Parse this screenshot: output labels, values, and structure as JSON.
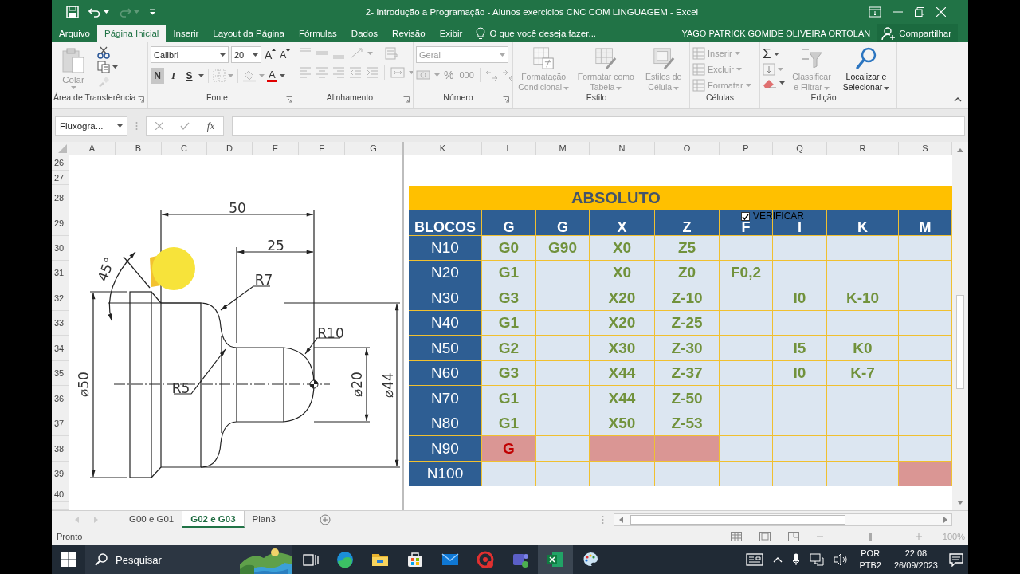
{
  "window": {
    "title": "2- Introdução a Programação - Alunos exercicios CNC COM LINGUAGEM - Excel"
  },
  "ribbon_tabs": [
    {
      "label": "Arquivo",
      "selected": false
    },
    {
      "label": "Página Inicial",
      "selected": true
    },
    {
      "label": "Inserir",
      "selected": false
    },
    {
      "label": "Layout da Página",
      "selected": false
    },
    {
      "label": "Fórmulas",
      "selected": false
    },
    {
      "label": "Dados",
      "selected": false
    },
    {
      "label": "Revisão",
      "selected": false
    },
    {
      "label": "Exibir",
      "selected": false
    }
  ],
  "tell_me": {
    "placeholder": "O que você deseja fazer..."
  },
  "user": "YAGO PATRICK GOMIDE OLIVEIRA ORTOLAN",
  "share_button": "Compartilhar",
  "ribbon": {
    "clipboard": {
      "label": "Área de Transferência",
      "paste": {
        "label": "Colar",
        "disabled": true
      }
    },
    "font": {
      "label": "Fonte",
      "font_name": "Calibri",
      "font_size": "20",
      "grow": "A",
      "shrink": "A",
      "font_color": "A",
      "toggles": [
        {
          "text": "N",
          "selected": true
        },
        {
          "text": "I",
          "selected": false
        },
        {
          "text": "S",
          "selected": false
        }
      ]
    },
    "alignment": {
      "label": "Alinhamento"
    },
    "number": {
      "label": "Número",
      "format": {
        "value": "Geral",
        "disabled": true
      },
      "percent": "%",
      "thousands": "000"
    },
    "styles": {
      "label": "Estilo",
      "buttons": [
        {
          "label": "Formatação Condicional",
          "disabled": true
        },
        {
          "label": "Formatar como Tabela",
          "disabled": true
        },
        {
          "label": "Estilos de Célula",
          "disabled": true
        }
      ]
    },
    "cells": {
      "label": "Células",
      "buttons": [
        {
          "label": "Inserir",
          "disabled": true
        },
        {
          "label": "Excluir",
          "disabled": true
        },
        {
          "label": "Formatar",
          "disabled": true
        }
      ]
    },
    "editing": {
      "label": "Edição",
      "sum": "Σ",
      "buttons": [
        {
          "label": "Classificar e Filtrar",
          "disabled": true
        },
        {
          "label": "Localizar e Selecionar",
          "disabled": false
        }
      ]
    }
  },
  "name_box": "Fluxogra...",
  "formula_bar": {
    "fx": "fx"
  },
  "left_columns": [
    "A",
    "B",
    "C",
    "D",
    "E",
    "F",
    "G"
  ],
  "right_columns": [
    "K",
    "L",
    "M",
    "N",
    "O",
    "P",
    "Q",
    "R",
    "S"
  ],
  "row_numbers": [
    "26",
    "27",
    "28",
    "29",
    "30",
    "31",
    "32",
    "33",
    "34",
    "35",
    "36",
    "37",
    "38",
    "39",
    "40"
  ],
  "drawing": {
    "labels": [
      "50",
      "25",
      "R7",
      "R10",
      "R5",
      "⌀50",
      "⌀20",
      "⌀44",
      "45°"
    ]
  },
  "table": {
    "title": "ABSOLUTO",
    "headers": [
      "BLOCOS",
      "G",
      "G",
      "X",
      "Z",
      "F",
      "I",
      "K",
      "M"
    ],
    "rows": [
      {
        "block": "N10",
        "cells": [
          {
            "text": "G0",
            "error": false
          },
          {
            "text": "G90",
            "error": false
          },
          {
            "text": "X0",
            "error": false
          },
          {
            "text": "Z5",
            "error": false
          },
          {
            "error": false
          },
          {
            "error": false
          },
          {
            "error": false
          },
          {
            "error": false
          }
        ]
      },
      {
        "block": "N20",
        "cells": [
          {
            "text": "G1",
            "error": false
          },
          {
            "error": false
          },
          {
            "text": "X0",
            "error": false
          },
          {
            "text": "Z0",
            "error": false
          },
          {
            "text": "F0,2",
            "error": false
          },
          {
            "error": false
          },
          {
            "error": false
          },
          {
            "error": false
          }
        ]
      },
      {
        "block": "N30",
        "cells": [
          {
            "text": "G3",
            "error": false
          },
          {
            "error": false
          },
          {
            "text": "X20",
            "error": false
          },
          {
            "text": "Z-10",
            "error": false
          },
          {
            "error": false
          },
          {
            "text": "I0",
            "error": false
          },
          {
            "text": "K-10",
            "error": false
          },
          {
            "error": false
          }
        ]
      },
      {
        "block": "N40",
        "cells": [
          {
            "text": "G1",
            "error": false
          },
          {
            "error": false
          },
          {
            "text": "X20",
            "error": false
          },
          {
            "text": "Z-25",
            "error": false
          },
          {
            "error": false
          },
          {
            "error": false
          },
          {
            "error": false
          },
          {
            "error": false
          }
        ]
      },
      {
        "block": "N50",
        "cells": [
          {
            "text": "G2",
            "error": false
          },
          {
            "error": false
          },
          {
            "text": "X30",
            "error": false
          },
          {
            "text": "Z-30",
            "error": false
          },
          {
            "error": false
          },
          {
            "text": "I5",
            "error": false
          },
          {
            "text": "K0",
            "error": false
          },
          {
            "error": false
          }
        ]
      },
      {
        "block": "N60",
        "cells": [
          {
            "text": "G3",
            "error": false
          },
          {
            "error": false
          },
          {
            "text": "X44",
            "error": false
          },
          {
            "text": "Z-37",
            "error": false
          },
          {
            "error": false
          },
          {
            "text": "I0",
            "error": false
          },
          {
            "text": "K-7",
            "error": false
          },
          {
            "error": false
          }
        ]
      },
      {
        "block": "N70",
        "cells": [
          {
            "text": "G1",
            "error": false
          },
          {
            "error": false
          },
          {
            "text": "X44",
            "error": false
          },
          {
            "text": "Z-50",
            "error": false
          },
          {
            "error": false
          },
          {
            "error": false
          },
          {
            "error": false
          },
          {
            "error": false
          }
        ]
      },
      {
        "block": "N80",
        "cells": [
          {
            "text": "G1",
            "error": false
          },
          {
            "error": false
          },
          {
            "text": "X50",
            "error": false
          },
          {
            "text": "Z-53",
            "error": false
          },
          {
            "error": false
          },
          {
            "error": false
          },
          {
            "error": false
          },
          {
            "error": false
          }
        ]
      },
      {
        "block": "N90",
        "cells": [
          {
            "text": "G",
            "error": true
          },
          {
            "error": false
          },
          {
            "error": true
          },
          {
            "error": true
          },
          {
            "error": false
          },
          {
            "error": false
          },
          {
            "error": false
          },
          {
            "error": false
          }
        ]
      },
      {
        "block": "N100",
        "cells": [
          {
            "error": false
          },
          {
            "error": false
          },
          {
            "error": false
          },
          {
            "error": false
          },
          {
            "error": false
          },
          {
            "error": false
          },
          {
            "error": false
          },
          {
            "error": true
          }
        ]
      }
    ]
  },
  "checkbox": {
    "label": "VERIFICAR",
    "checked": true
  },
  "sheet_tabs": [
    {
      "label": "G00 e G01",
      "selected": false
    },
    {
      "label": "G02 e G03",
      "selected": true
    },
    {
      "label": "Plan3",
      "selected": false
    }
  ],
  "status_bar": {
    "text": "Pronto",
    "zoom": {
      "level": 0.5,
      "reading": "100%"
    }
  },
  "taskbar": {
    "search": {
      "placeholder": "Pesquisar"
    },
    "apps": [
      {
        "selected": false
      },
      {
        "selected": false
      },
      {
        "selected": false
      },
      {
        "selected": false
      },
      {
        "selected": false
      },
      {
        "selected": false
      },
      {
        "selected": true
      },
      {
        "selected": false
      }
    ],
    "language": "POR",
    "layout": "PTB2",
    "time": "22:08",
    "date": "26/09/2023"
  }
}
